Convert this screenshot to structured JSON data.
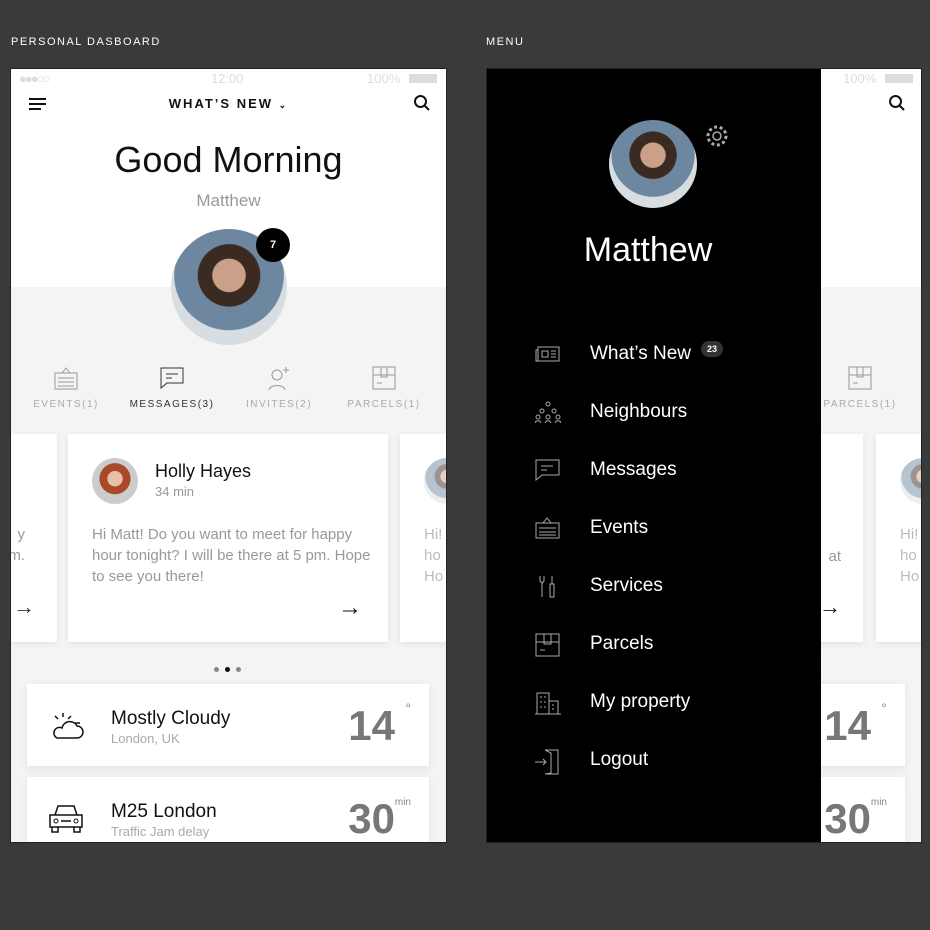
{
  "captions": {
    "left": "PERSONAL DASBOARD",
    "right": "MENU"
  },
  "status": {
    "time": "12:00",
    "battery": "100%"
  },
  "header": {
    "title": "WHAT’S NEW"
  },
  "greeting": "Good Morning",
  "user_name": "Matthew",
  "notification_count": "7",
  "tabs": [
    {
      "label": "EVENTS(1)"
    },
    {
      "label": "MESSAGES(3)",
      "active": true
    },
    {
      "label": "INVITES(2)"
    },
    {
      "label": "PARCELS(1)"
    }
  ],
  "message": {
    "sender": "Holly Hayes",
    "time": "34 min",
    "text": "Hi Matt! Do you want to meet for happy hour tonight? I will be there at 5 pm. Hope to see you there!"
  },
  "side_cards": {
    "left_lines": [
      "y",
      "m."
    ],
    "right_lines": [
      "Hi!",
      "ho",
      "Ho"
    ]
  },
  "pager": {
    "count": 3,
    "active": 1
  },
  "weather": {
    "title": "Mostly Cloudy",
    "location": "London, UK",
    "value": "14",
    "unit": "°"
  },
  "traffic": {
    "title": "M25 London",
    "subtitle": "Traffic Jam delay",
    "value": "30",
    "unit": "min"
  },
  "menu": {
    "name": "Matthew",
    "items": [
      {
        "label": "What’s New",
        "badge": "23",
        "icon": "newspaper-icon"
      },
      {
        "label": "Neighbours",
        "icon": "people-icon"
      },
      {
        "label": "Messages",
        "icon": "message-icon"
      },
      {
        "label": "Events",
        "icon": "calendar-icon"
      },
      {
        "label": "Services",
        "icon": "tools-icon"
      },
      {
        "label": "Parcels",
        "icon": "parcel-icon"
      },
      {
        "label": "My property",
        "icon": "building-icon"
      },
      {
        "label": "Logout",
        "icon": "logout-icon"
      }
    ]
  },
  "behind": {
    "tab": "PARCELS(1)",
    "partial_text": "at"
  }
}
